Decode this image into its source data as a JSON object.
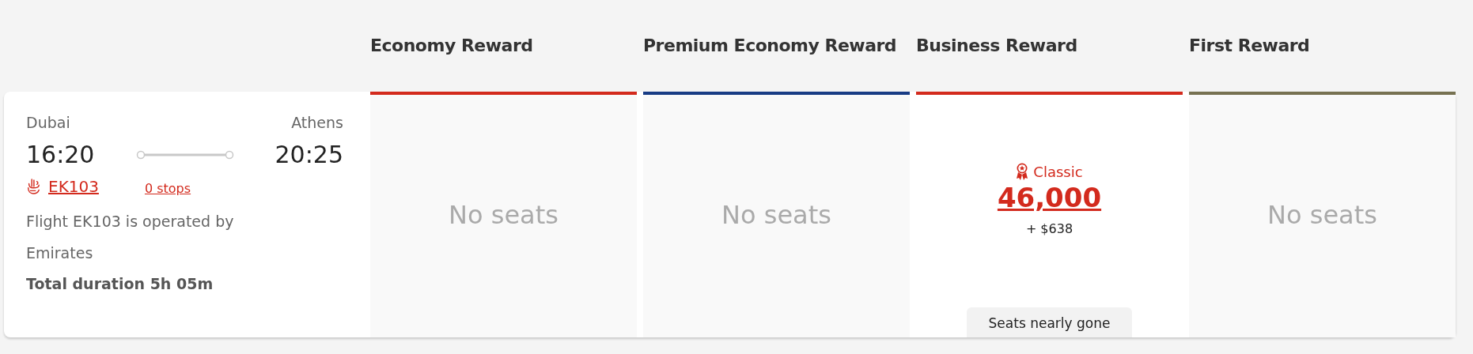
{
  "flight": {
    "origin": "Dubai",
    "destination": "Athens",
    "departure_time": "16:20",
    "arrival_time": "20:25",
    "flight_number": "EK103",
    "stops": "0 stops",
    "operator_note": "Flight EK103 is operated by Emirates",
    "duration": "Total duration 5h 05m"
  },
  "fare_columns": [
    {
      "title": "Economy Reward",
      "color": "#d32a1d",
      "kind": "none",
      "message": "No seats"
    },
    {
      "title": "Premium Economy Reward",
      "color": "#183c85",
      "kind": "none",
      "message": "No seats"
    },
    {
      "title": "Business Reward",
      "color": "#d32a1d",
      "kind": "offer",
      "award": "Classic",
      "points": "46,000",
      "fee": "+ $638",
      "availability": "Seats nearly gone"
    },
    {
      "title": "First Reward",
      "color": "#777252",
      "kind": "none",
      "message": "No seats"
    }
  ]
}
